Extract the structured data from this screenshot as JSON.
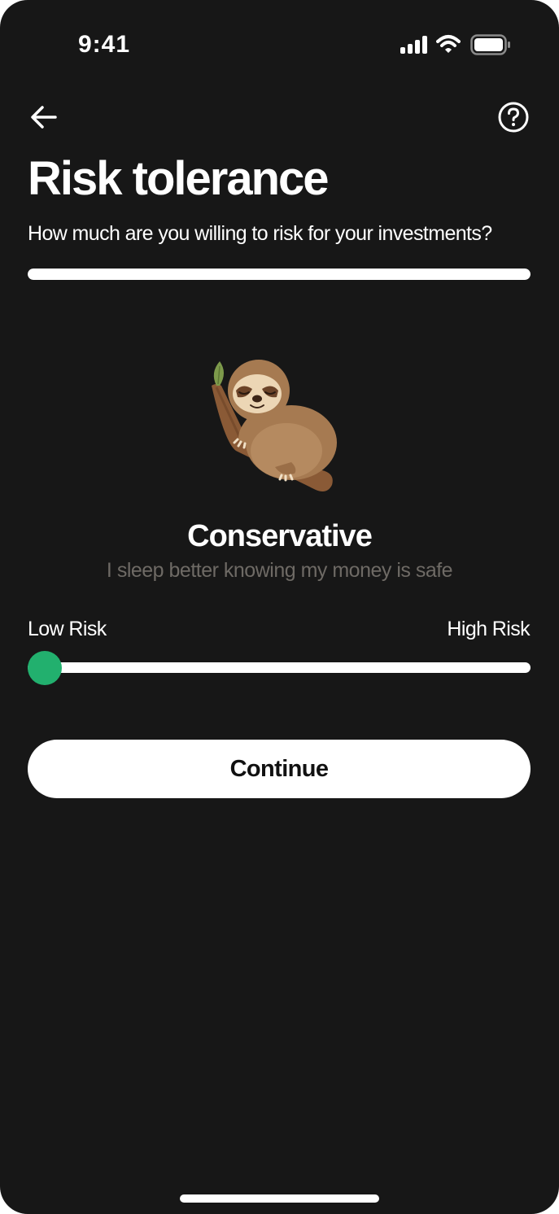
{
  "status_bar": {
    "time": "9:41",
    "icons": [
      "cellular-signal-icon",
      "wifi-icon",
      "battery-icon"
    ]
  },
  "nav": {
    "back_icon": "arrow-left-icon",
    "help_icon": "question-circle-icon"
  },
  "header": {
    "title": "Risk tolerance",
    "subtitle": "How much are you willing to risk for your investments?",
    "progress_fraction": 1.0
  },
  "risk_profile": {
    "mascot_icon": "sleeping-sloth-illustration",
    "level": "Conservative",
    "description": "I sleep better knowing my money is safe"
  },
  "slider": {
    "low_label": "Low Risk",
    "high_label": "High Risk",
    "value_fraction": 0.0
  },
  "actions": {
    "continue_label": "Continue"
  },
  "colors": {
    "background": "#171717",
    "accent_green": "#22b06e",
    "muted_text": "#6e6a65",
    "button_bg": "#ffffff"
  }
}
